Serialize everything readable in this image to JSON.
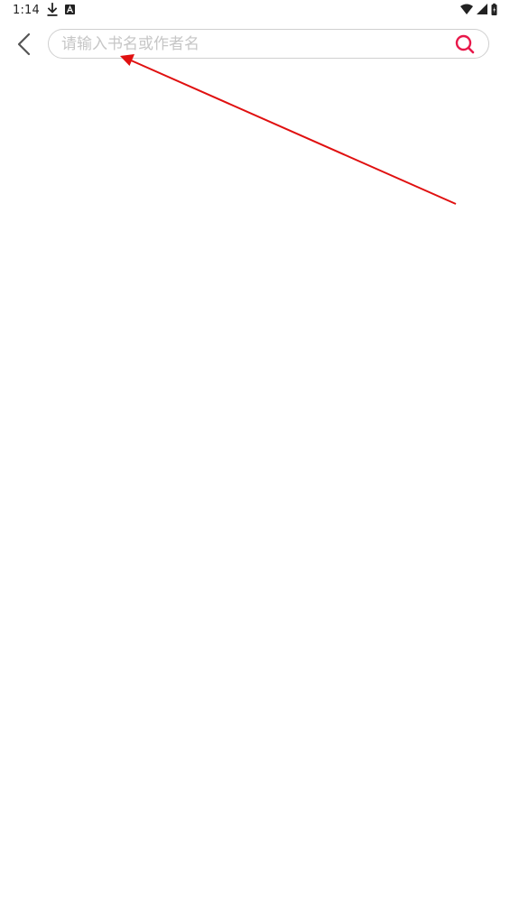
{
  "status_bar": {
    "time": "1:14",
    "icons": [
      "download-icon",
      "a-notification-icon",
      "wifi-icon",
      "cell-signal-icon",
      "battery-icon"
    ]
  },
  "search": {
    "placeholder": "请输入书名或作者名",
    "value": "",
    "accent_color": "#e8184a"
  },
  "annotation": {
    "type": "arrow",
    "color": "#e01010"
  }
}
